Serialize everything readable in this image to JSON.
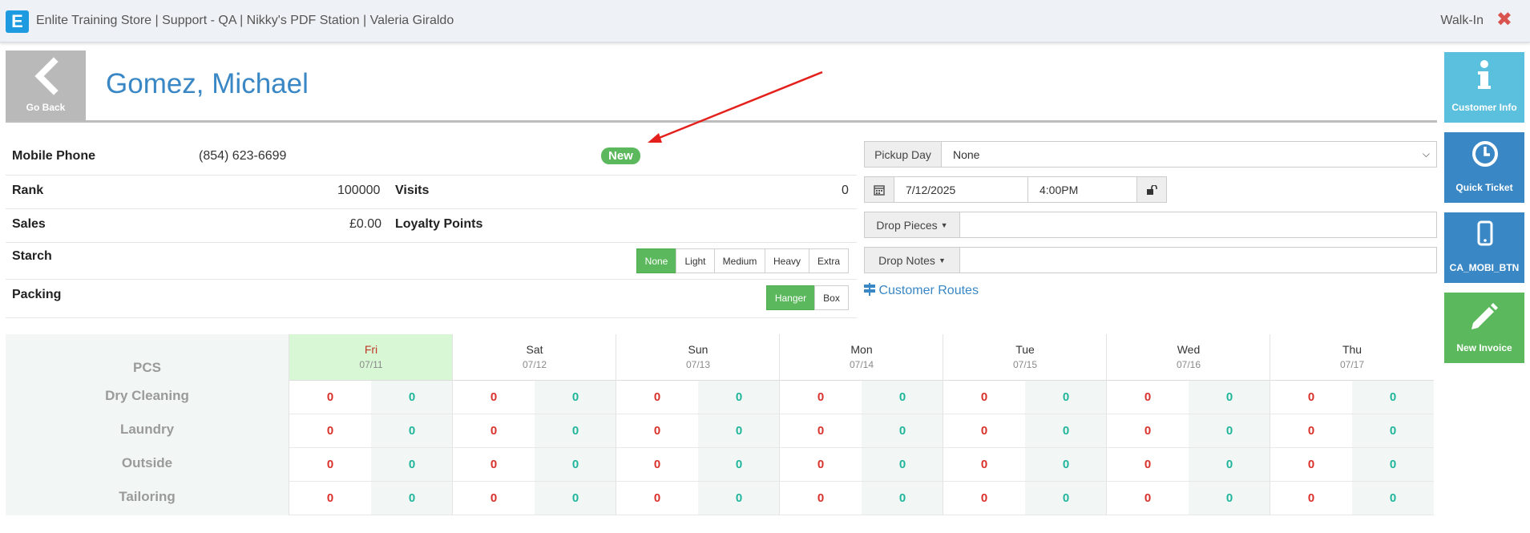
{
  "topbar": {
    "logo_letter": "E",
    "title": "Enlite Training Store | Support - QA | Nikky's PDF Station | Valeria Giraldo",
    "mode": "Walk-In"
  },
  "header": {
    "go_back_label": "Go Back",
    "customer_name": "Gomez, Michael"
  },
  "info": {
    "mobile_phone_label": "Mobile Phone",
    "mobile_phone": "(854) 623-6699",
    "status_badge": "New",
    "rank_label": "Rank",
    "rank": "100000",
    "visits_label": "Visits",
    "visits": "0",
    "sales_label": "Sales",
    "sales": "£0.00",
    "loyalty_label": "Loyalty Points",
    "loyalty": "",
    "starch_label": "Starch",
    "starch_options": [
      "None",
      "Light",
      "Medium",
      "Heavy",
      "Extra"
    ],
    "starch_selected": "None",
    "packing_label": "Packing",
    "packing_options": [
      "Hanger",
      "Box"
    ],
    "packing_selected": "Hanger"
  },
  "order": {
    "pickup_day_label": "Pickup Day",
    "pickup_day_value": "None",
    "date": "7/12/2025",
    "time": "4:00PM",
    "drop_pieces_label": "Drop Pieces",
    "drop_notes_label": "Drop Notes",
    "customer_routes_label": "Customer Routes"
  },
  "tiles": [
    {
      "label": "Customer Info",
      "color": "#5bc0de"
    },
    {
      "label": "Quick Ticket",
      "color": "#3a87c5"
    },
    {
      "label": "CA_MOBI_BTN",
      "color": "#3a87c5"
    },
    {
      "label": "New Invoice",
      "color": "#5cb85c"
    }
  ],
  "schedule": {
    "pcs_label": "PCS",
    "services": [
      "Dry Cleaning",
      "Laundry",
      "Outside",
      "Tailoring"
    ],
    "days": [
      {
        "name": "Fri",
        "date": "07/11",
        "today": true
      },
      {
        "name": "Sat",
        "date": "07/12",
        "today": false
      },
      {
        "name": "Sun",
        "date": "07/13",
        "today": false
      },
      {
        "name": "Mon",
        "date": "07/14",
        "today": false
      },
      {
        "name": "Tue",
        "date": "07/15",
        "today": false
      },
      {
        "name": "Wed",
        "date": "07/16",
        "today": false
      },
      {
        "name": "Thu",
        "date": "07/17",
        "today": false
      }
    ],
    "cells": [
      [
        [
          "0",
          "0"
        ],
        [
          "0",
          "0"
        ],
        [
          "0",
          "0"
        ],
        [
          "0",
          "0"
        ],
        [
          "0",
          "0"
        ],
        [
          "0",
          "0"
        ],
        [
          "0",
          "0"
        ]
      ],
      [
        [
          "0",
          "0"
        ],
        [
          "0",
          "0"
        ],
        [
          "0",
          "0"
        ],
        [
          "0",
          "0"
        ],
        [
          "0",
          "0"
        ],
        [
          "0",
          "0"
        ],
        [
          "0",
          "0"
        ]
      ],
      [
        [
          "0",
          "0"
        ],
        [
          "0",
          "0"
        ],
        [
          "0",
          "0"
        ],
        [
          "0",
          "0"
        ],
        [
          "0",
          "0"
        ],
        [
          "0",
          "0"
        ],
        [
          "0",
          "0"
        ]
      ],
      [
        [
          "0",
          "0"
        ],
        [
          "0",
          "0"
        ],
        [
          "0",
          "0"
        ],
        [
          "0",
          "0"
        ],
        [
          "0",
          "0"
        ],
        [
          "0",
          "0"
        ],
        [
          "0",
          "0"
        ]
      ]
    ]
  },
  "colors": {
    "accent_blue": "#3a87c5",
    "success_green": "#5cb85c",
    "danger_red": "#d9312b",
    "teal": "#1fb59b"
  }
}
